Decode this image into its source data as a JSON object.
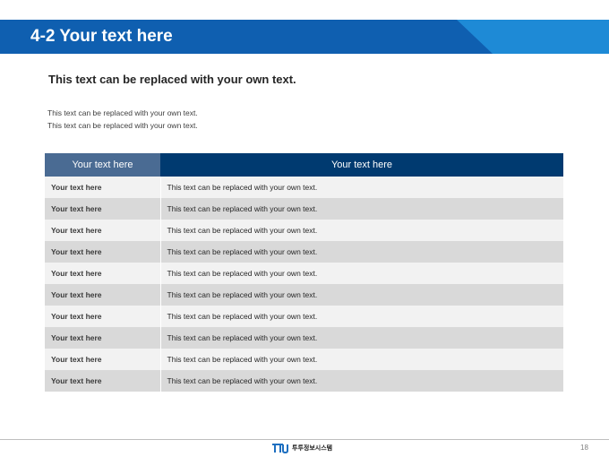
{
  "colors": {
    "title_bar": "#0f5fb0",
    "title_accent": "#1e8ad6",
    "table_header_left": "#4a6b93",
    "table_header_right": "#003a70",
    "row_light": "#f2f2f2",
    "row_dark": "#d9d9d9"
  },
  "header": {
    "title": "4-2 Your text here"
  },
  "subheading": "This text can be replaced with your own text.",
  "body_lines": [
    "This text can be replaced with your own text.",
    "This text can be replaced with your own text."
  ],
  "table": {
    "headers": [
      "Your text here",
      "Your text here"
    ],
    "rows": [
      [
        "Your text here",
        "This text can be replaced with your own text."
      ],
      [
        "Your text here",
        "This text can be replaced with your own text."
      ],
      [
        "Your text here",
        "This text can be replaced with your own text."
      ],
      [
        "Your text here",
        "This text can be replaced with your own text."
      ],
      [
        "Your text here",
        "This text can be replaced with your own text."
      ],
      [
        "Your text here",
        "This text can be replaced with your own text."
      ],
      [
        "Your text here",
        "This text can be replaced with your own text."
      ],
      [
        "Your text here",
        "This text can be replaced with your own text."
      ],
      [
        "Your text here",
        "This text can be replaced with your own text."
      ],
      [
        "Your text here",
        "This text can be replaced with your own text."
      ]
    ]
  },
  "footer": {
    "logo_text": "투투정보시스템",
    "page_number": "18"
  }
}
